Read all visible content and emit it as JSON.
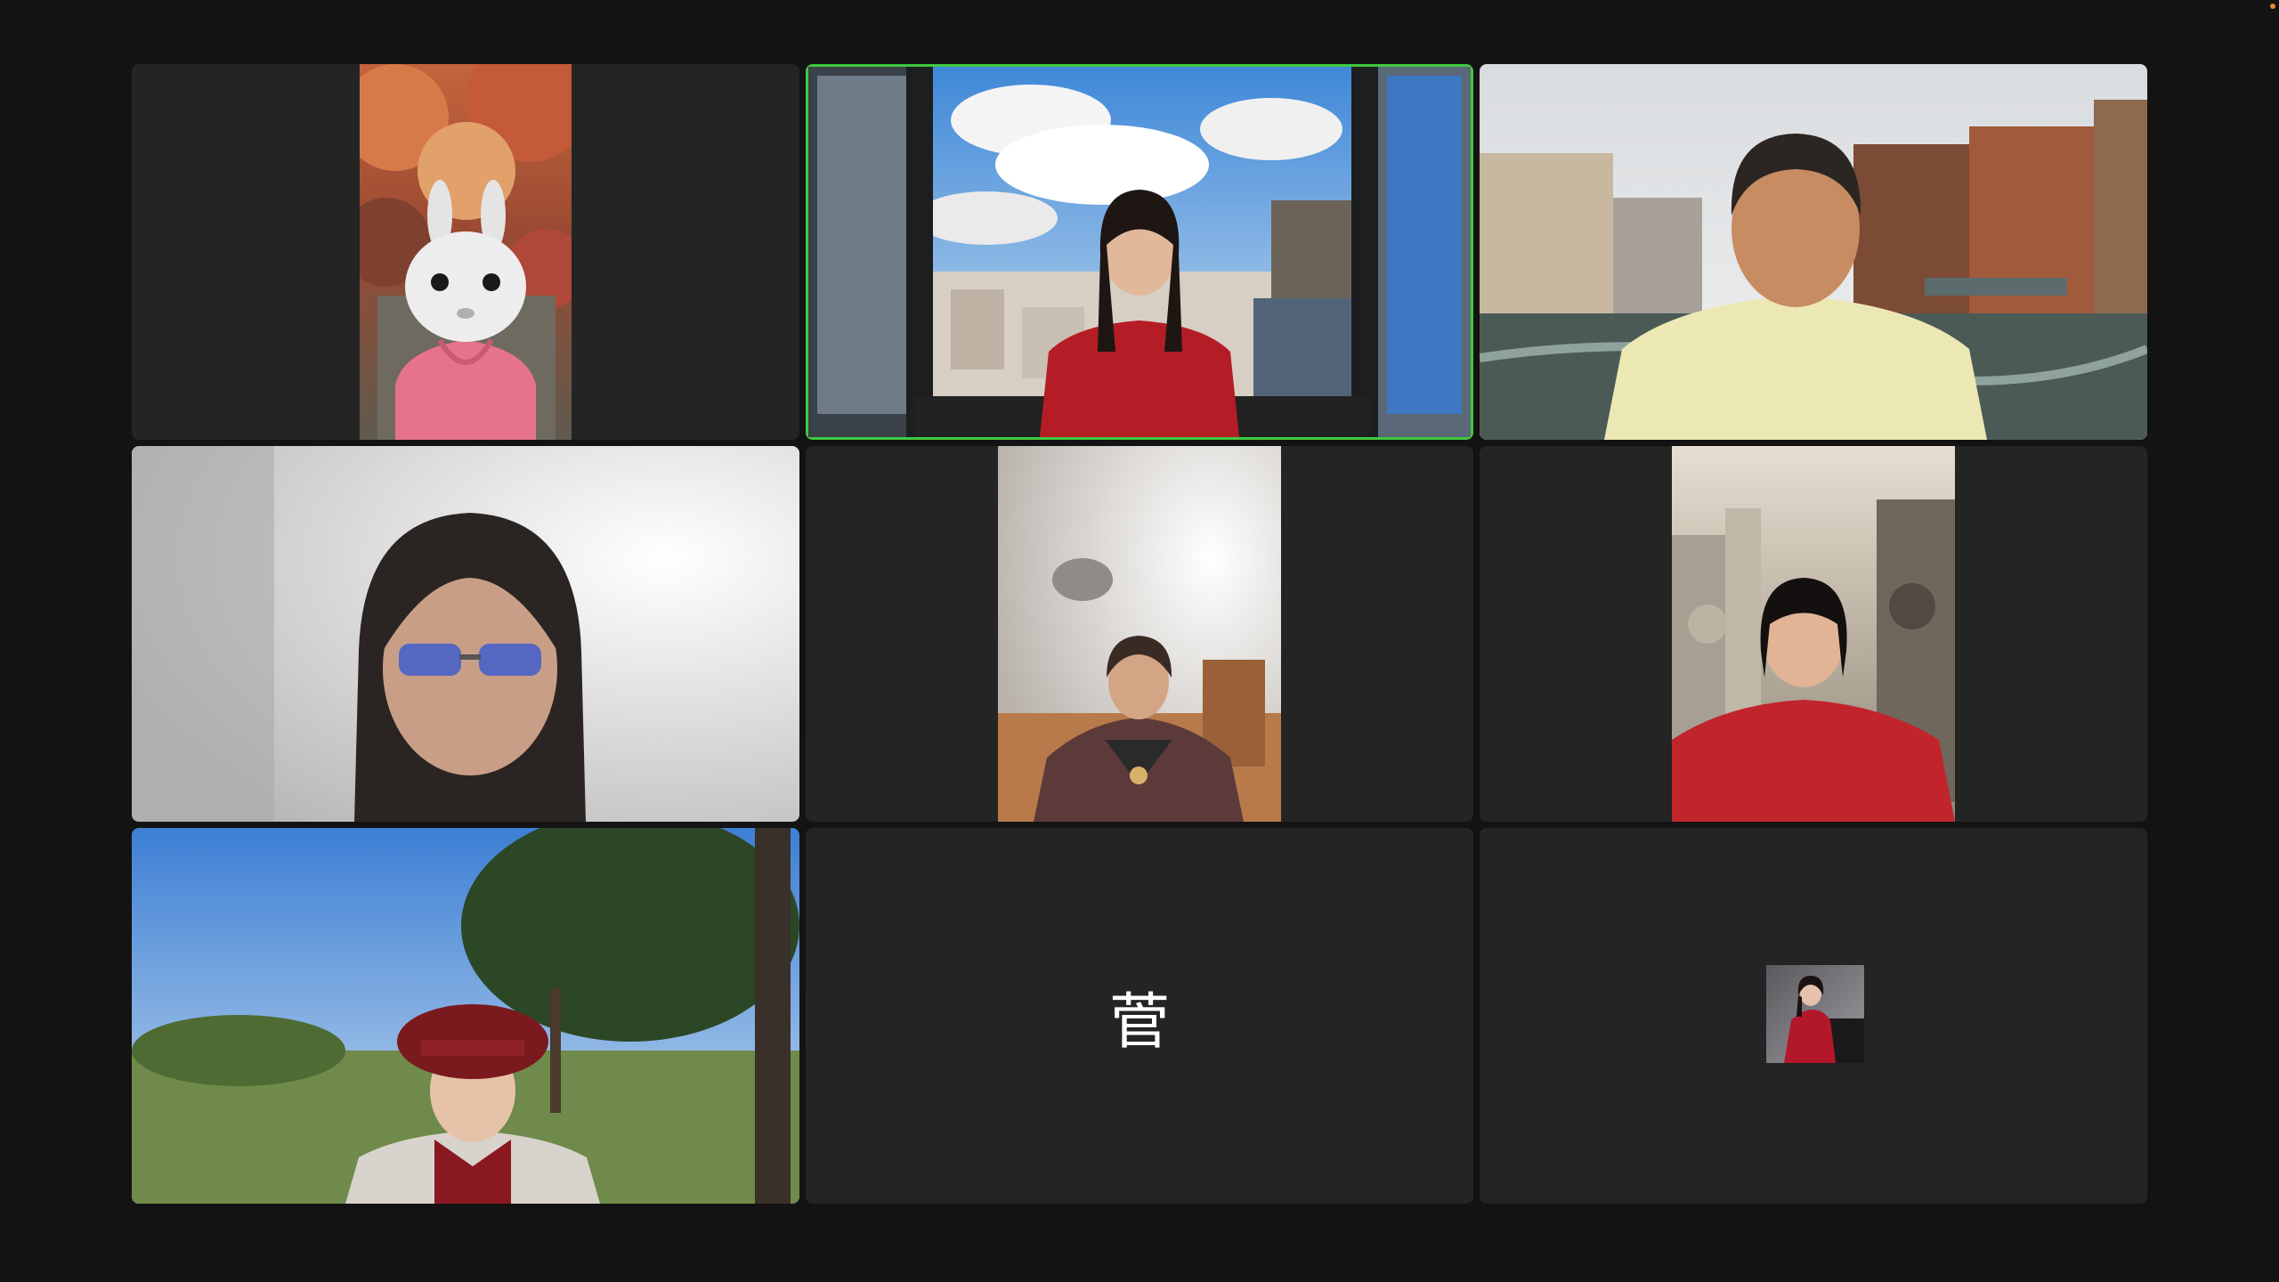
{
  "meeting": {
    "view": "gallery",
    "participant_count": 9,
    "accent_color": "#3fc93f",
    "status_indicator_color": "#e8862a"
  },
  "participants": [
    {
      "tile": 1,
      "video": "on",
      "active_speaker": false,
      "background": "autumn-forest",
      "avatar": "bunny-mask"
    },
    {
      "tile": 2,
      "video": "on",
      "active_speaker": true,
      "background": "paris-rooftops-window"
    },
    {
      "tile": 3,
      "video": "on",
      "active_speaker": false,
      "background": "strasbourg-canal"
    },
    {
      "tile": 4,
      "video": "on",
      "active_speaker": false,
      "background": "white-room"
    },
    {
      "tile": 5,
      "video": "on",
      "active_speaker": false,
      "background": "ceiling-lamp-room"
    },
    {
      "tile": 6,
      "video": "on",
      "active_speaker": false,
      "background": "stone-sculpture-wall"
    },
    {
      "tile": 7,
      "video": "on",
      "active_speaker": false,
      "background": "park-trees"
    },
    {
      "tile": 8,
      "video": "off",
      "active_speaker": false,
      "initial": "菅"
    },
    {
      "tile": 9,
      "video": "off",
      "active_speaker": false,
      "profile_photo": "pianist-red-dress"
    }
  ]
}
